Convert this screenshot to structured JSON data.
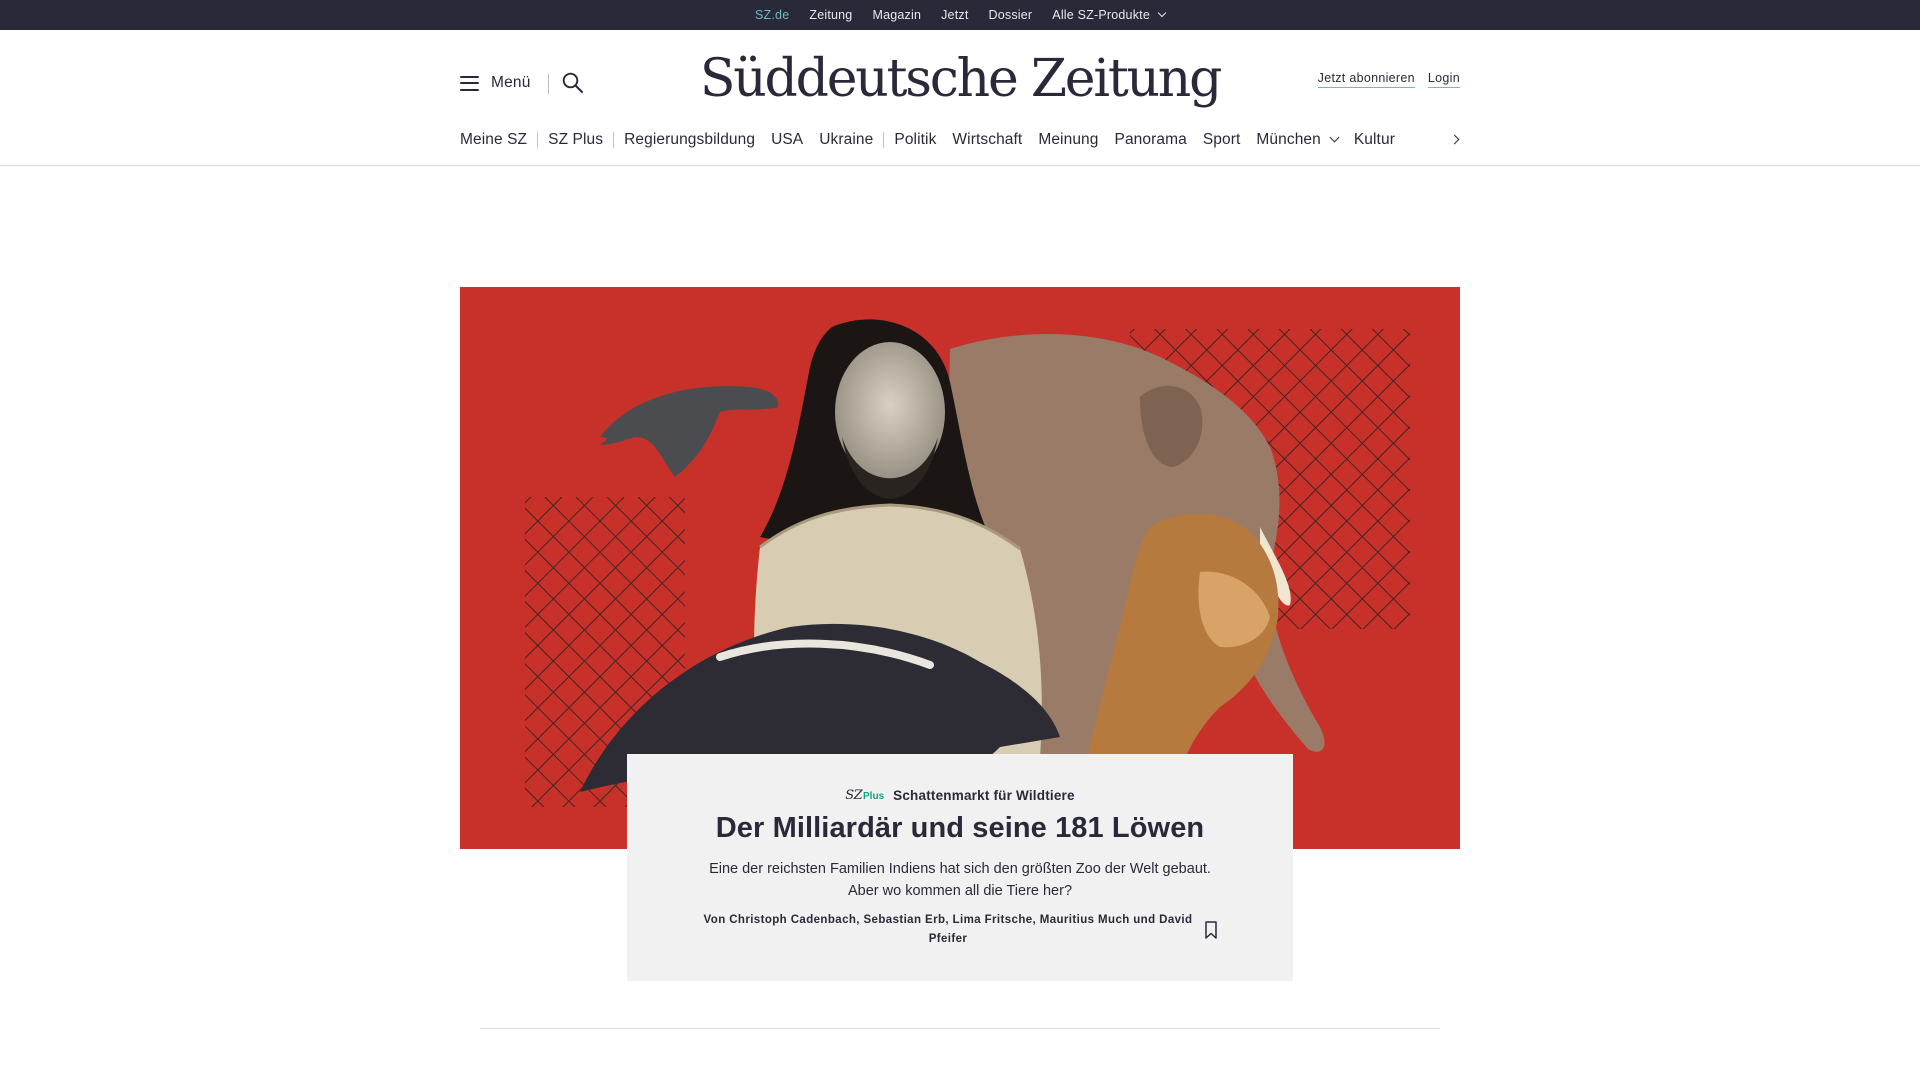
{
  "topbar": {
    "links": [
      "SZ.de",
      "Zeitung",
      "Magazin",
      "Jetzt",
      "Dossier",
      "Alle SZ-Produkte"
    ],
    "active": "SZ.de"
  },
  "header": {
    "menu_label": "Menü",
    "logo": "Süddeutsche Zeitung",
    "subscribe": "Jetzt abonnieren",
    "login": "Login"
  },
  "ressorts": [
    "Meine SZ",
    "SZ Plus",
    "Regierungsbildung",
    "USA",
    "Ukraine",
    "Politik",
    "Wirtschaft",
    "Meinung",
    "Panorama",
    "Sport",
    "München",
    "Kultur"
  ],
  "teaser": {
    "badge_sz": "SZ",
    "badge_plus": "Plus",
    "kicker": "Schattenmarkt für Wildtiere",
    "headline": "Der Milliardär und seine 181 Löwen",
    "text": "Eine der reichsten Familien Indiens hat sich den größten Zoo der Welt gebaut. Aber wo kommen all die Tiere her?",
    "author": "Von Christoph Cadenbach, Sebastian Erb, Lima Fritsche, Mauritius Much und David Pfeifer"
  },
  "colors": {
    "brand_dark": "#29293a",
    "accent_teal": "#71b8c4",
    "plus_green": "#14a089",
    "hero_red": "#c8312a",
    "card_bg": "#f1f1f1"
  },
  "icons": [
    "hamburger-icon",
    "search-icon",
    "chevron-down-icon",
    "chevron-right-icon",
    "bookmark-icon"
  ]
}
